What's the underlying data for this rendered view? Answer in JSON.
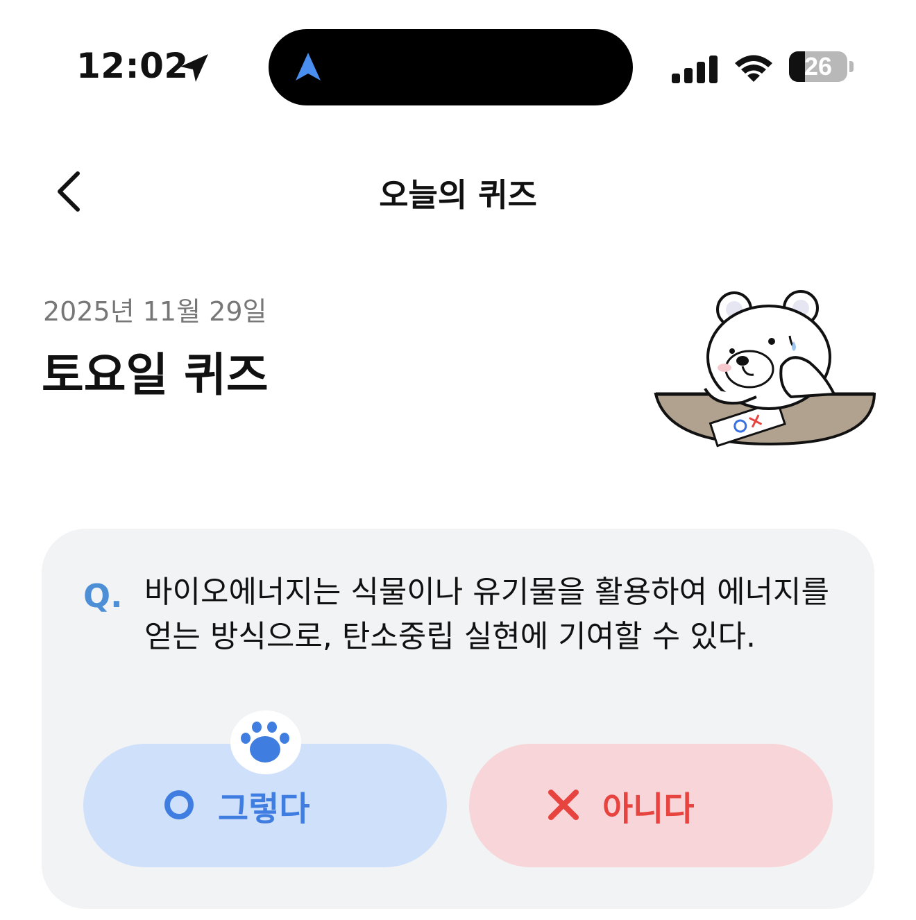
{
  "status_bar": {
    "time": "12:02",
    "battery": "26",
    "icons": [
      "location-arrow-icon",
      "navigation-icon",
      "signal-icon",
      "wifi-icon",
      "battery-icon"
    ]
  },
  "nav": {
    "back_icon": "chevron-left-icon",
    "title": "오늘의 퀴즈"
  },
  "header": {
    "date": "2025년 11월 29일",
    "title": "토요일 퀴즈",
    "illustration": "bear-with-ox-sheet"
  },
  "question": {
    "mark": "Q.",
    "text": "바이오에너지는 식물이나 유기물을 활용하여 에너지를 얻는 방식으로, 탄소중립 실현에 기여할 수 있다."
  },
  "answers": {
    "yes": {
      "icon": "circle-o-icon",
      "label": "그렇다"
    },
    "no": {
      "icon": "x-mark-icon",
      "label": "아니다"
    },
    "hint_icon": "paw-icon"
  },
  "colors": {
    "accent_blue": "#4d8fd6",
    "yes_bg": "#cfe0fb",
    "yes_fg": "#3f7de0",
    "no_bg": "#f7d5d9",
    "no_fg": "#e8443f",
    "card_bg": "#f2f3f5"
  }
}
